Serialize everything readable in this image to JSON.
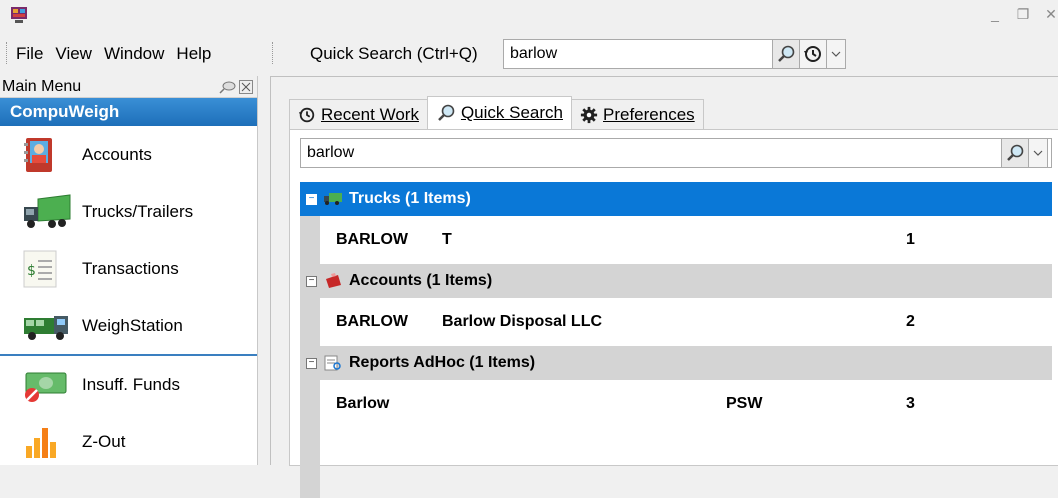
{
  "menubar": {
    "items": [
      "File",
      "View",
      "Window",
      "Help"
    ],
    "quick_search_label": "Quick Search (Ctrl+Q)",
    "quick_search_value": "barlow"
  },
  "left_panel": {
    "header": "Main Menu",
    "section": "CompuWeigh",
    "items": [
      {
        "label": "Accounts",
        "icon": "accounts-book-icon"
      },
      {
        "label": "Trucks/Trailers",
        "icon": "truck-icon"
      },
      {
        "label": "Transactions",
        "icon": "receipt-icon"
      },
      {
        "label": "WeighStation",
        "icon": "weigh-truck-icon"
      },
      {
        "label": "Insuff. Funds",
        "icon": "insufficient-funds-icon"
      },
      {
        "label": "Z-Out",
        "icon": "z-out-chart-icon"
      }
    ]
  },
  "tabs": [
    {
      "label": "Recent Work",
      "icon": "history-icon"
    },
    {
      "label": "Quick Search",
      "icon": "search-icon"
    },
    {
      "label": "Preferences",
      "icon": "gear-icon"
    }
  ],
  "active_tab": "Quick Search",
  "search": {
    "value": "barlow"
  },
  "results": {
    "groups": [
      {
        "title": "Trucks (1 Items)",
        "selected": true,
        "rows": [
          {
            "c1": "BARLOW",
            "c2": "T",
            "c3": "",
            "c4": "1"
          }
        ]
      },
      {
        "title": "Accounts (1 Items)",
        "selected": false,
        "rows": [
          {
            "c1": "BARLOW",
            "c2": "Barlow Disposal LLC",
            "c3": "",
            "c4": "2"
          }
        ]
      },
      {
        "title": "Reports AdHoc (1 Items)",
        "selected": false,
        "rows": [
          {
            "c1": "Barlow",
            "c2": "",
            "c3": "PSW",
            "c4": "3"
          }
        ]
      }
    ]
  },
  "colors": {
    "accent": "#0a78d7",
    "group_bg": "#d4d4d4",
    "section_header": "#1e6fb9"
  }
}
